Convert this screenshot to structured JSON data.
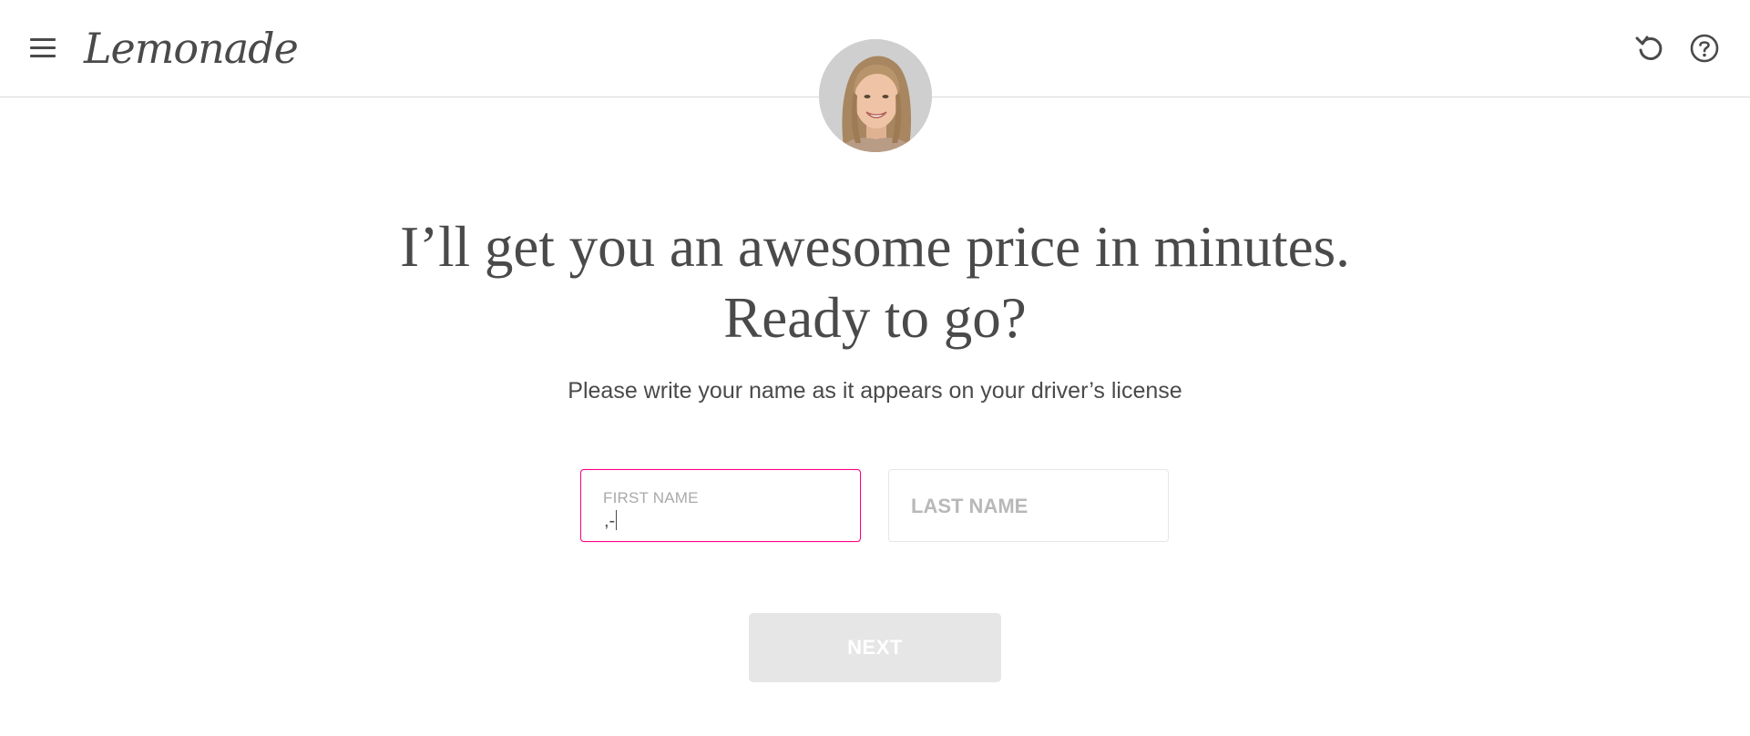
{
  "header": {
    "logo_text": "Lemonade",
    "menu_icon": "hamburger-menu-icon",
    "restart_icon": "restart-icon",
    "help_icon": "help-icon"
  },
  "agent": {
    "avatar": "agent-avatar-photo"
  },
  "main": {
    "headline_line1": "I’ll get you an awesome price in minutes.",
    "headline_line2": "Ready to go?",
    "subtitle": "Please write your name as it appears on your driver’s license",
    "first_name": {
      "label": "FIRST NAME",
      "value": ",-"
    },
    "last_name": {
      "placeholder": "LAST NAME"
    },
    "next_label": "NEXT"
  },
  "colors": {
    "accent": "#ff0083",
    "text": "#4a4a4a",
    "disabled_button": "#e6e6e6",
    "placeholder": "#b8b8b8"
  }
}
